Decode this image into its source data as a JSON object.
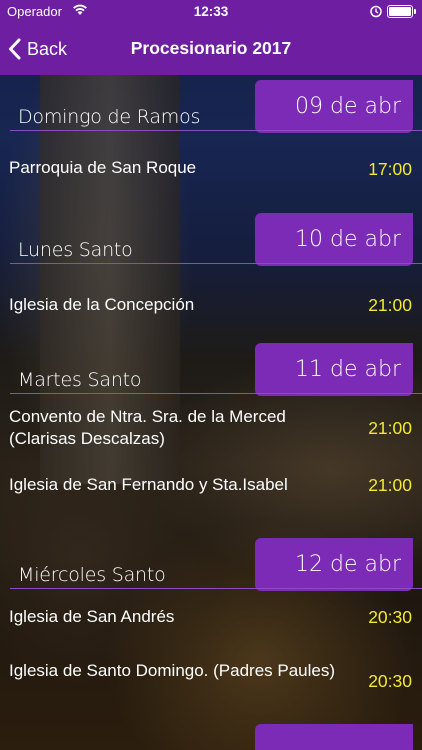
{
  "status_bar": {
    "carrier": "Operador",
    "time": "12:33"
  },
  "nav": {
    "back_label": "Back",
    "title": "Procesionario 2017"
  },
  "colors": {
    "accent": "#7b2bb6",
    "nav_bg": "#6e1fa1",
    "time_text": "#f3ea2b"
  },
  "days": [
    {
      "name": "Domingo de Ramos",
      "date": "09 de abr",
      "events": [
        {
          "place": "Parroquia de San Roque",
          "time": "17:00"
        }
      ]
    },
    {
      "name": "Lunes Santo",
      "date": "10 de abr",
      "events": [
        {
          "place": "Iglesia de la Concepción",
          "time": "21:00"
        }
      ]
    },
    {
      "name": "Martes Santo",
      "date": "11 de abr",
      "events": [
        {
          "place": "Convento de Ntra. Sra. de la Merced (Clarisas Descalzas)",
          "time": "21:00"
        },
        {
          "place": "Iglesia de San Fernando y Sta.Isabel",
          "time": "21:00"
        }
      ]
    },
    {
      "name": "Miércoles Santo",
      "date": "12 de abr",
      "events": [
        {
          "place": "Iglesia de San Andrés",
          "time": "20:30"
        },
        {
          "place": "Iglesia de Santo Domingo. (Padres Paules)",
          "time": "20:30"
        }
      ]
    }
  ]
}
